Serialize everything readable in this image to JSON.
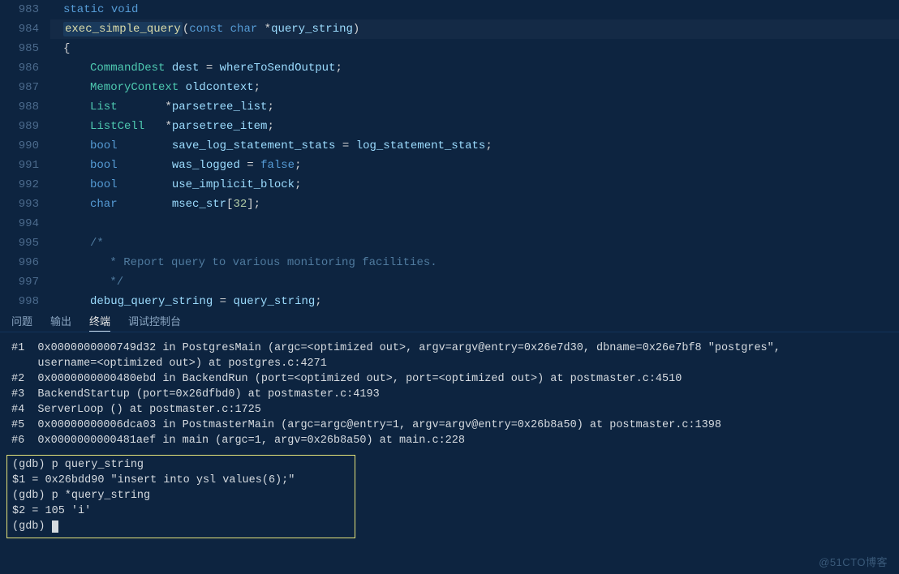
{
  "editor": {
    "lines": [
      {
        "num": "983",
        "tokens": [
          [
            "kw",
            "static"
          ],
          [
            "op",
            " "
          ],
          [
            "kw",
            "void"
          ]
        ],
        "indent": 1
      },
      {
        "num": "984",
        "highlight": true,
        "tokens": [
          [
            "fn hl",
            "exec_simple_query"
          ],
          [
            "pn",
            "("
          ],
          [
            "kw",
            "const"
          ],
          [
            "op",
            " "
          ],
          [
            "kw",
            "char"
          ],
          [
            "op",
            " "
          ],
          [
            "op",
            "*"
          ],
          [
            "var",
            "query_string"
          ],
          [
            "pn",
            ")"
          ]
        ],
        "indent": 1
      },
      {
        "num": "985",
        "tokens": [
          [
            "pn",
            "{"
          ]
        ],
        "indent": 1
      },
      {
        "num": "986",
        "tokens": [
          [
            "type",
            "CommandDest"
          ],
          [
            "op",
            " "
          ],
          [
            "var",
            "dest"
          ],
          [
            "op",
            " "
          ],
          [
            "op",
            "="
          ],
          [
            "op",
            " "
          ],
          [
            "var",
            "whereToSendOutput"
          ],
          [
            "pn",
            ";"
          ]
        ],
        "indent": 2
      },
      {
        "num": "987",
        "tokens": [
          [
            "type",
            "MemoryContext"
          ],
          [
            "op",
            " "
          ],
          [
            "var",
            "oldcontext"
          ],
          [
            "pn",
            ";"
          ]
        ],
        "indent": 2
      },
      {
        "num": "988",
        "tokens": [
          [
            "type",
            "List"
          ],
          [
            "op",
            "       "
          ],
          [
            "op",
            "*"
          ],
          [
            "var",
            "parsetree_list"
          ],
          [
            "pn",
            ";"
          ]
        ],
        "indent": 2
      },
      {
        "num": "989",
        "tokens": [
          [
            "type",
            "ListCell"
          ],
          [
            "op",
            "   "
          ],
          [
            "op",
            "*"
          ],
          [
            "var",
            "parsetree_item"
          ],
          [
            "pn",
            ";"
          ]
        ],
        "indent": 2
      },
      {
        "num": "990",
        "tokens": [
          [
            "kw",
            "bool"
          ],
          [
            "op",
            "        "
          ],
          [
            "var",
            "save_log_statement_stats"
          ],
          [
            "op",
            " "
          ],
          [
            "op",
            "="
          ],
          [
            "op",
            " "
          ],
          [
            "var",
            "log_statement_stats"
          ],
          [
            "pn",
            ";"
          ]
        ],
        "indent": 2
      },
      {
        "num": "991",
        "tokens": [
          [
            "kw",
            "bool"
          ],
          [
            "op",
            "        "
          ],
          [
            "var",
            "was_logged"
          ],
          [
            "op",
            " "
          ],
          [
            "op",
            "="
          ],
          [
            "op",
            " "
          ],
          [
            "kw",
            "false"
          ],
          [
            "pn",
            ";"
          ]
        ],
        "indent": 2
      },
      {
        "num": "992",
        "tokens": [
          [
            "kw",
            "bool"
          ],
          [
            "op",
            "        "
          ],
          [
            "var",
            "use_implicit_block"
          ],
          [
            "pn",
            ";"
          ]
        ],
        "indent": 2
      },
      {
        "num": "993",
        "tokens": [
          [
            "kw",
            "char"
          ],
          [
            "op",
            "        "
          ],
          [
            "var",
            "msec_str"
          ],
          [
            "pn",
            "["
          ],
          [
            "num",
            "32"
          ],
          [
            "pn",
            "]"
          ],
          [
            "pn",
            ";"
          ]
        ],
        "indent": 2
      },
      {
        "num": "994",
        "tokens": [],
        "indent": 2
      },
      {
        "num": "995",
        "tokens": [
          [
            "cmt",
            "/*"
          ]
        ],
        "indent": 2
      },
      {
        "num": "996",
        "tokens": [
          [
            "cmt",
            " * Report query to various monitoring facilities."
          ]
        ],
        "indent": 2,
        "extra": 1
      },
      {
        "num": "997",
        "tokens": [
          [
            "cmt",
            " */"
          ]
        ],
        "indent": 2,
        "extra": 1
      },
      {
        "num": "998",
        "tokens": [
          [
            "var",
            "debug_query_string"
          ],
          [
            "op",
            " "
          ],
          [
            "op",
            "="
          ],
          [
            "op",
            " "
          ],
          [
            "var",
            "query_string"
          ],
          [
            "pn",
            ";"
          ]
        ],
        "indent": 2
      }
    ]
  },
  "panel": {
    "tabs": [
      {
        "label": "问题",
        "active": false
      },
      {
        "label": "输出",
        "active": false
      },
      {
        "label": "终端",
        "active": true
      },
      {
        "label": "调试控制台",
        "active": false
      }
    ],
    "stack": [
      "#1  0x0000000000749d32 in PostgresMain (argc=<optimized out>, argv=argv@entry=0x26e7d30, dbname=0x26e7bf8 \"postgres\",",
      "    username=<optimized out>) at postgres.c:4271",
      "#2  0x0000000000480ebd in BackendRun (port=<optimized out>, port=<optimized out>) at postmaster.c:4510",
      "#3  BackendStartup (port=0x26dfbd0) at postmaster.c:4193",
      "#4  ServerLoop () at postmaster.c:1725",
      "#5  0x00000000006dca03 in PostmasterMain (argc=argc@entry=1, argv=argv@entry=0x26b8a50) at postmaster.c:1398",
      "#6  0x0000000000481aef in main (argc=1, argv=0x26b8a50) at main.c:228"
    ],
    "gdb": [
      "(gdb) p query_string",
      "$1 = 0x26bdd90 \"insert into ysl values(6);\"",
      "(gdb) p *query_string",
      "$2 = 105 'i'",
      "(gdb) "
    ]
  },
  "watermark": "@51CTO博客"
}
